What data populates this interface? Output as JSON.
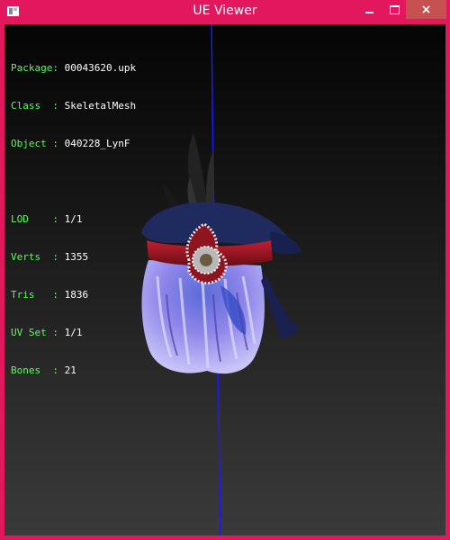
{
  "window": {
    "title": "UE Viewer"
  },
  "controls": {
    "minimize": "minimize",
    "maximize": "maximize",
    "close": "×"
  },
  "info": {
    "package_key": "Package: ",
    "package": "00043620.upk",
    "class_key": "Class  : ",
    "class": "SkeletalMesh",
    "object_key": "Object : ",
    "object": "040228_LynF",
    "lod_key": "LOD    : ",
    "lod": "1/1",
    "verts_key": "Verts  : ",
    "verts": "1355",
    "tris_key": "Tris   : ",
    "tris": "1836",
    "uvset_key": "UV Set : ",
    "uvset": "1/1",
    "bones_key": "Bones  : ",
    "bones": "21"
  },
  "colors": {
    "frame": "#e2175e",
    "info_key": "#55ff55",
    "info_value": "#ffffff",
    "axis": "#1a1aff",
    "hat": "#1f2b5e",
    "band": "#a01a26",
    "hair": "#9a8ff0"
  }
}
